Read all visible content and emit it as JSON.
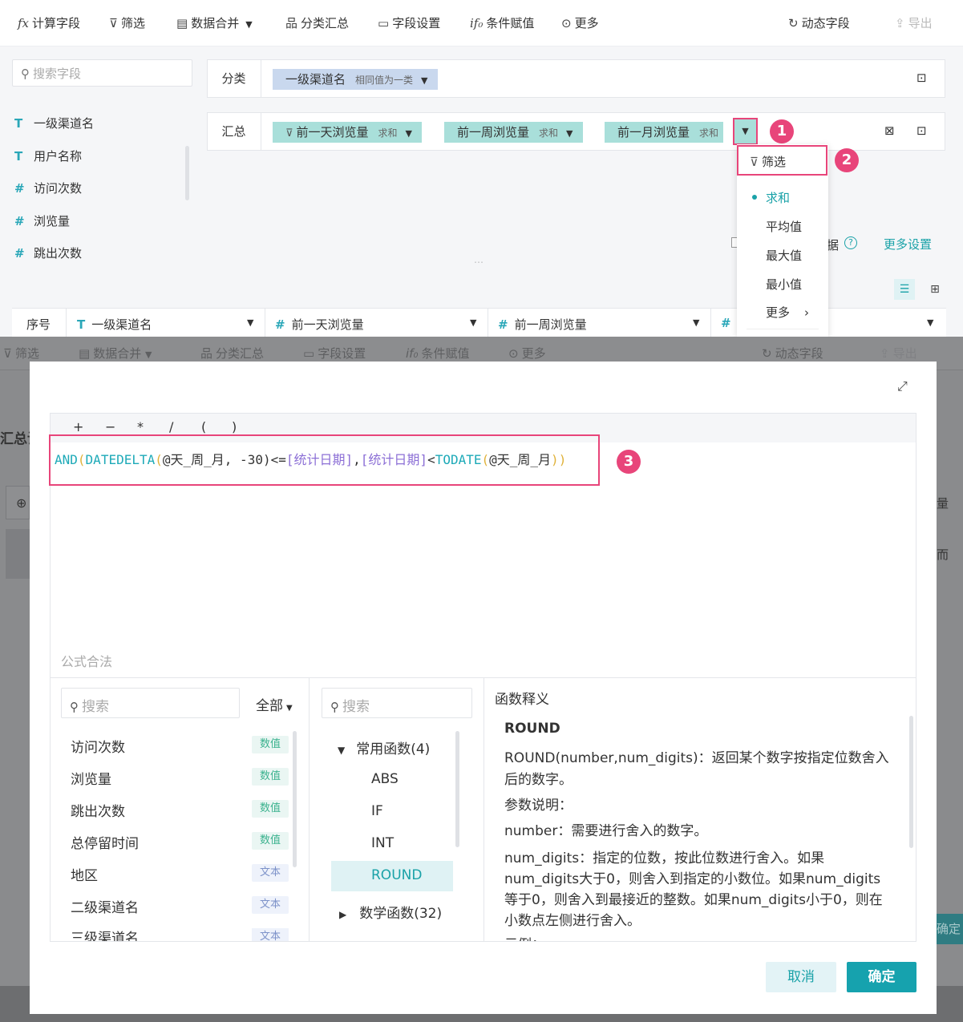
{
  "toolbar": {
    "calc_field": "计算字段",
    "filter": "筛选",
    "merge": "数据合并",
    "group_summary": "分类汇总",
    "field_settings": "字段设置",
    "conditional": "条件赋值",
    "more": "更多",
    "dynamic_field": "动态字段",
    "export": "导出"
  },
  "left_panel": {
    "search_placeholder": "搜索字段",
    "fields": [
      {
        "type": "T",
        "name": "一级渠道名"
      },
      {
        "type": "T",
        "name": "用户名称"
      },
      {
        "type": "#",
        "name": "访问次数"
      },
      {
        "type": "#",
        "name": "浏览量"
      },
      {
        "type": "#",
        "name": "跳出次数"
      }
    ]
  },
  "group_row": {
    "label": "分类",
    "pill": {
      "name": "一级渠道名",
      "sub": "相同值为一类"
    }
  },
  "summary_row": {
    "label": "汇总",
    "pills": [
      {
        "name": "前一天浏览量",
        "agg": "求和"
      },
      {
        "name": "前一周浏览量",
        "agg": "求和"
      },
      {
        "name": "前一月浏览量",
        "agg": "求和"
      }
    ]
  },
  "dropdown": {
    "filter": "筛选",
    "items": [
      "求和",
      "平均值",
      "最大值",
      "最小值",
      "更多"
    ],
    "selected": "求和"
  },
  "partial_text": "据",
  "more_settings": "更多设置",
  "table_head": {
    "cols": [
      "序号",
      "一级渠道名",
      "前一天浏览量",
      "前一周浏览量"
    ]
  },
  "badges": [
    "1",
    "2",
    "3"
  ],
  "background_toolbar": {
    "filter": "筛选",
    "merge": "数据合并",
    "group_summary": "分类汇总",
    "field_settings": "字段设置",
    "conditional": "条件赋值",
    "more": "更多",
    "dynamic_field": "动态字段",
    "export": "导出",
    "left_partial": "汇总设",
    "right_partial_1": "量",
    "right_partial_2": "而",
    "right_partial_3": "确定"
  },
  "modal": {
    "operators": [
      "+",
      "−",
      "*",
      "/",
      "(",
      ")"
    ],
    "formula": {
      "p1": "AND",
      "p2": "(",
      "p3": "DATEDELTA",
      "p4": "(",
      "p5": "@天_周_月, -30)<=",
      "p6": "[统计日期]",
      "p7": ",",
      "p8": "[统计日期]",
      "p9": "<",
      "p10": "TODATE",
      "p11": "(",
      "p12": "@天_周_月",
      "p13": ")",
      "p14": ")"
    },
    "legal_status": "公式合法",
    "field_search_placeholder": "搜索",
    "field_filter": "全部",
    "fields": [
      {
        "name": "访问次数",
        "type": "数值"
      },
      {
        "name": "浏览量",
        "type": "数值"
      },
      {
        "name": "跳出次数",
        "type": "数值"
      },
      {
        "name": "总停留时间",
        "type": "数值"
      },
      {
        "name": "地区",
        "type": "文本"
      },
      {
        "name": "二级渠道名",
        "type": "文本"
      },
      {
        "name": "三级渠道名",
        "type": "文本"
      }
    ],
    "func_search_placeholder": "搜索",
    "func_groups": [
      {
        "name": "常用函数(4)",
        "expanded": true,
        "items": [
          "ABS",
          "IF",
          "INT",
          "ROUND"
        ]
      },
      {
        "name": "数学函数(32)",
        "expanded": false
      }
    ],
    "selected_func": "ROUND",
    "desc_title": "函数释义",
    "desc": {
      "name": "ROUND",
      "line1": "ROUND(number,num_digits)：返回某个数字按指定位数舍入",
      "line2": "后的数字。",
      "line3": "参数说明：",
      "line4": "number：需要进行舍入的数字。",
      "line5": "num_digits：指定的位数，按此位数进行舍入。如果",
      "line6": "num_digits大于0，则舍入到指定的小数位。如果num_digits",
      "line7": "等于0，则舍入到最接近的整数。如果num_digits小于0，则在",
      "line8": "小数点左侧进行舍入。",
      "line9": "示例："
    },
    "cancel": "取消",
    "ok": "确定"
  },
  "colors": {
    "accent": "#16a2ae",
    "highlight": "#e8457a",
    "pill_blue": "#c9d8ee",
    "pill_teal": "#a9dfda"
  }
}
